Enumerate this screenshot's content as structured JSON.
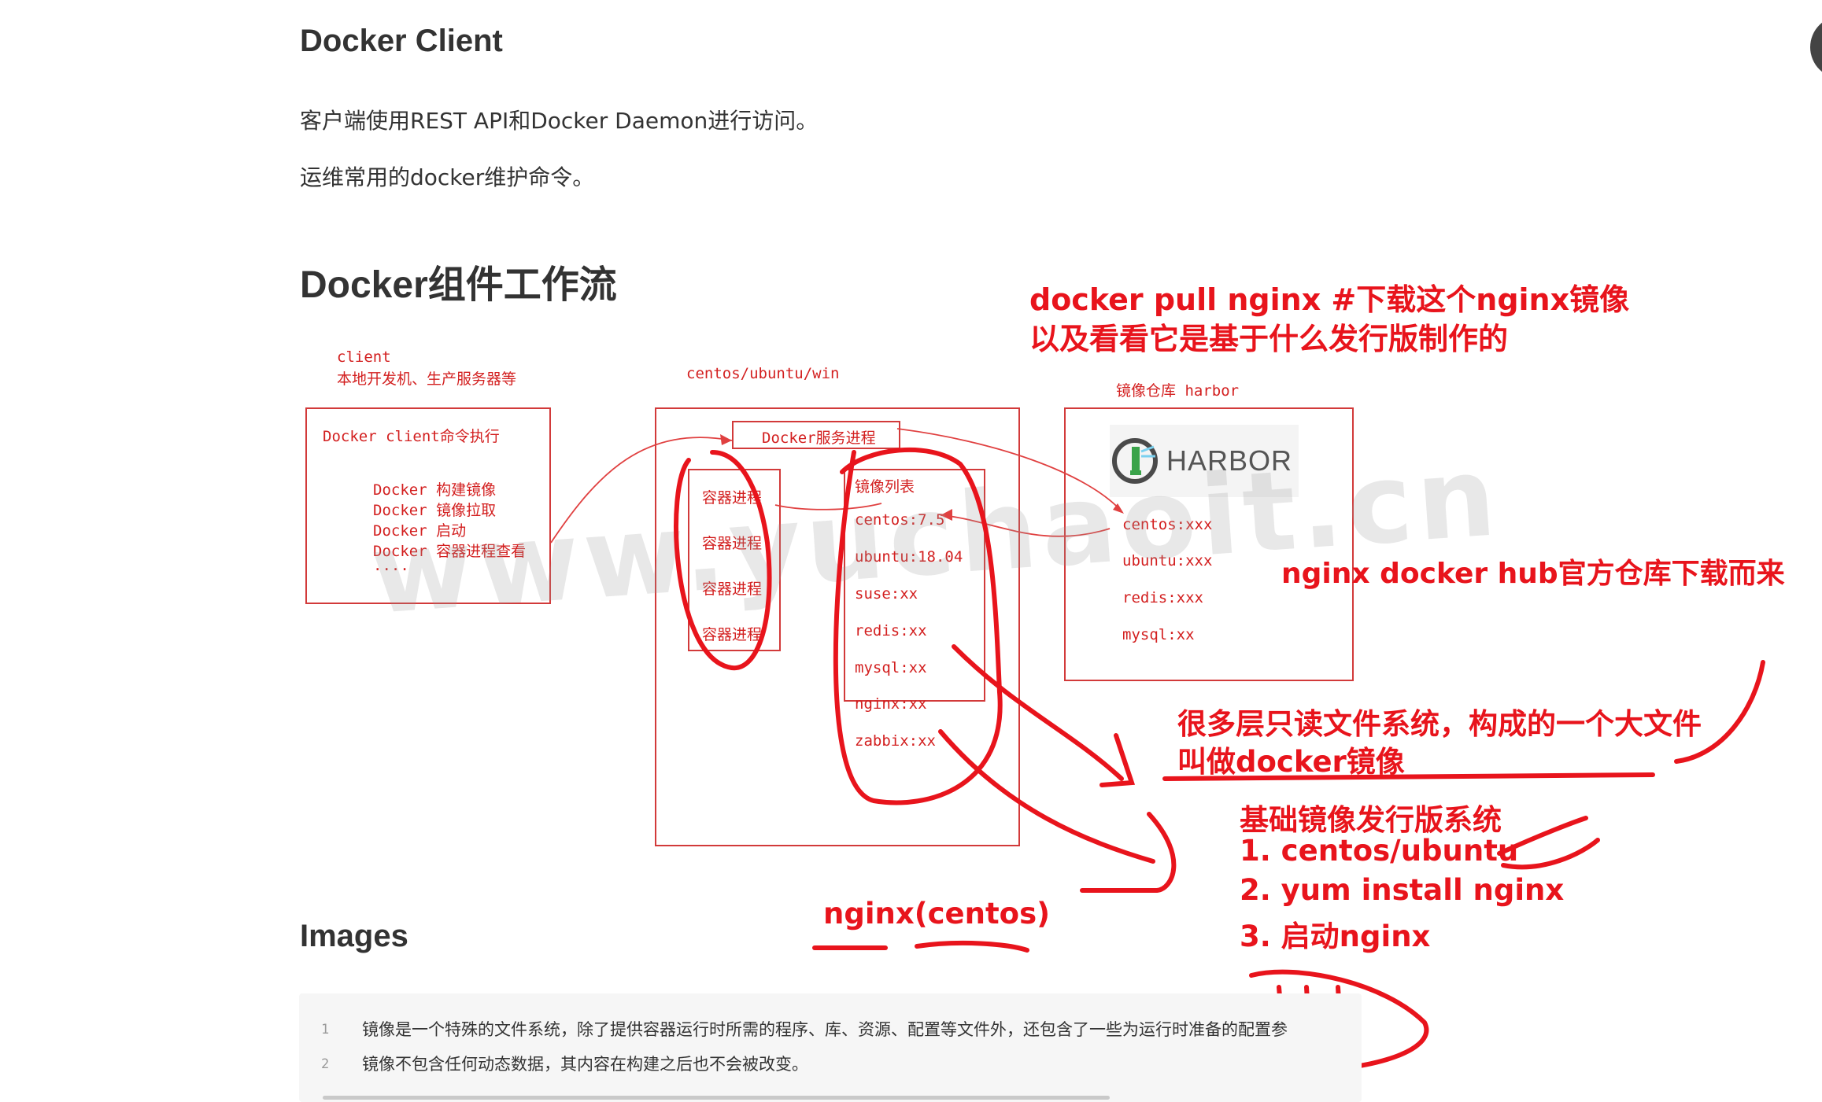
{
  "doc": {
    "h_client": "Docker Client",
    "p1": "客户端使用REST API和Docker Daemon进行访问。",
    "p2": "运维常用的docker维护命令。",
    "h_flow": "Docker组件工作流",
    "h_images": "Images"
  },
  "diagram": {
    "client_title": "client",
    "client_subtitle": "本地开发机、生产服务器等",
    "client_box_title": "Docker client命令执行",
    "client_cmds": [
      "Docker 构建镜像",
      "Docker 镜像拉取",
      "Docker 启动",
      "Docker 容器进程查看"
    ],
    "client_more": "....",
    "host_label": "centos/ubuntu/win",
    "daemon_label": "Docker服务进程",
    "containers": [
      "容器进程",
      "容器进程",
      "容器进程",
      "容器进程"
    ],
    "image_list_title": "镜像列表",
    "images": [
      "centos:7.5",
      "ubuntu:18.04",
      "suse:xx",
      "redis:xx",
      "mysql:xx",
      "nginx:xx",
      "zabbix:xx"
    ],
    "registry_label": "镜像仓库 harbor",
    "harbor_logo_text": "HARBOR",
    "registry_images": [
      "centos:xxx",
      "ubuntu:xxx",
      "redis:xxx",
      "mysql:xx"
    ],
    "watermark": "www.yuchaoit.cn"
  },
  "annotations": {
    "pull_line1": "docker  pull  nginx  #下载这个nginx镜像",
    "pull_line2": "以及看看它是基于什么发行版制作的",
    "hub_note": "nginx docker hub官方仓库下载而来",
    "layers_line1": "很多层只读文件系统，构成的一个大文件",
    "layers_line2": "叫做docker镜像",
    "base_title": "基础镜像发行版系统",
    "steps": [
      "1. centos/ubuntu",
      "2.   yum install nginx",
      "3.   启动nginx"
    ],
    "nginx_centos": "nginx(centos)"
  },
  "code": {
    "lines": [
      {
        "no": "1",
        "text": "镜像是一个特殊的文件系统，除了提供容器运行时所需的程序、库、资源、配置等文件外，还包含了一些为运行时准备的配置参"
      },
      {
        "no": "2",
        "text": "镜像不包含任何动态数据，其内容在构建之后也不会被改变。"
      }
    ]
  },
  "colors": {
    "accent_red": "#e8141c",
    "diagram_red": "#d23a3a",
    "text": "#333333"
  }
}
